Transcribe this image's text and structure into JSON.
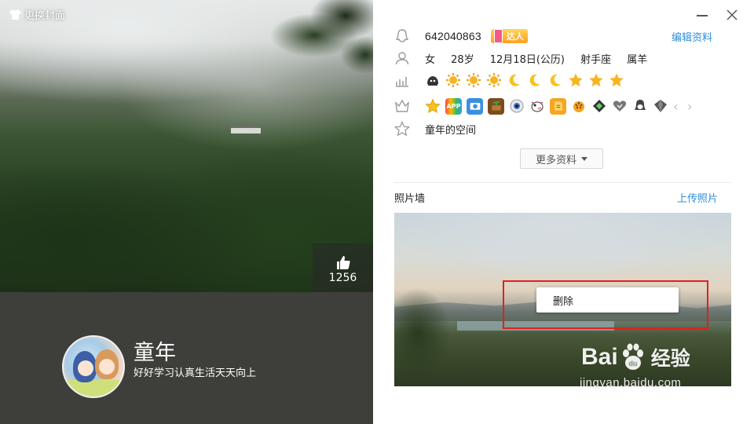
{
  "cover": {
    "change_cover_label": "更换封面",
    "like_count": "1256",
    "nickname": "童年",
    "signature": "好好学习认真生活天天向上"
  },
  "profile": {
    "qq_number": "642040863",
    "daren_badge": "达人",
    "edit_label": "编辑资料",
    "gender": "女",
    "age": "28岁",
    "birthday": "12月18日(公历)",
    "zodiac": "射手座",
    "chinese_zodiac": "属羊",
    "level_icons": [
      "crown-icon",
      "sun-icon",
      "sun-icon",
      "sun-icon",
      "moon-icon",
      "moon-icon",
      "moon-icon",
      "star-icon",
      "star-icon",
      "star-icon"
    ],
    "service_icons": [
      "star-service-icon",
      "app-service-icon",
      "camera-service-icon",
      "farm-service-icon",
      "eye-service-icon",
      "cow-service-icon",
      "card-service-icon",
      "tiger-service-icon",
      "game-service-icon",
      "heart-service-icon",
      "penguin-service-icon",
      "gem-service-icon"
    ],
    "space_label": "童年的空间",
    "more_info_label": "更多资料"
  },
  "photo_wall": {
    "title": "照片墙",
    "upload_label": "上传照片",
    "context_menu": {
      "delete_label": "删除"
    }
  },
  "watermark": {
    "brand_a": "Bai",
    "brand_b": "经验",
    "url": "jingyan.baidu.com"
  },
  "colors": {
    "link_blue": "#2f8fdb",
    "highlight_red": "#e0211f",
    "profile_bar": "#3e3f3a"
  }
}
